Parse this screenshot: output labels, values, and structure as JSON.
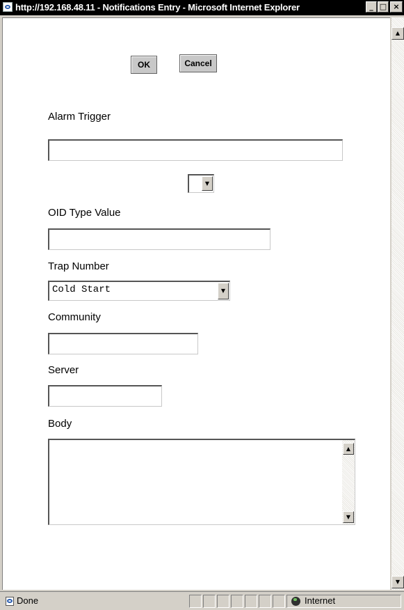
{
  "window": {
    "title": "http://192.168.48.11 - Notifications Entry - Microsoft Internet Explorer",
    "minimize_label": "_",
    "maximize_label": "□",
    "close_label": "×"
  },
  "form": {
    "ok_label": "OK",
    "cancel_label": "Cancel",
    "alarm_trigger_label": "Alarm Trigger",
    "alarm_trigger_value": "",
    "alarm_select_value": "",
    "oid_label": "OID Type Value",
    "oid_value": "",
    "trap_label": "Trap Number",
    "trap_value": "Cold Start",
    "community_label": "Community",
    "community_value": "",
    "server_label": "Server",
    "server_value": "",
    "body_label": "Body",
    "body_value": ""
  },
  "statusbar": {
    "status_text": "Done",
    "zone_text": "Internet"
  },
  "icons": {
    "dropdown": "dropdown-arrow-icon",
    "scroll_up": "scroll-up-icon",
    "scroll_down": "scroll-down-icon",
    "page": "ie-page-icon",
    "globe": "internet-globe-icon"
  }
}
